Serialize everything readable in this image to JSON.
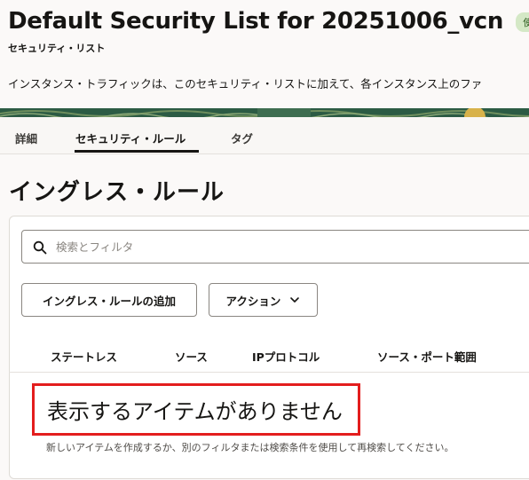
{
  "header": {
    "title": "Default Security List for 20251006_vcn",
    "status_badge": "使用可能",
    "subtitle": "セキュリティ・リスト",
    "description": "インスタンス・トラフィックは、このセキュリティ・リストに加えて、各インスタンス上のファ"
  },
  "tabs": [
    {
      "label": "詳細"
    },
    {
      "label": "セキュリティ・ルール"
    },
    {
      "label": "タグ"
    }
  ],
  "section": {
    "title": "イングレス・ルール"
  },
  "search": {
    "placeholder": "検索とフィルタ",
    "value": ""
  },
  "toolbar": {
    "add_label": "イングレス・ルールの追加",
    "actions_label": "アクション"
  },
  "table": {
    "columns": [
      "ステートレス",
      "ソース",
      "IPプロトコル",
      "ソース・ポート範囲"
    ]
  },
  "empty_state": {
    "title": "表示するアイテムがありません",
    "hint": "新しいアイテムを作成するか、別のフィルタまたは検索条件を使用して再検索してください。"
  },
  "colors": {
    "accent": "#161513",
    "badge_bg": "#d4e8c6",
    "highlight": "#e31d1d",
    "banner": "#2c5b44"
  },
  "icons": {
    "search": "search-icon",
    "actions_dropdown": "chevron-down-icon"
  }
}
